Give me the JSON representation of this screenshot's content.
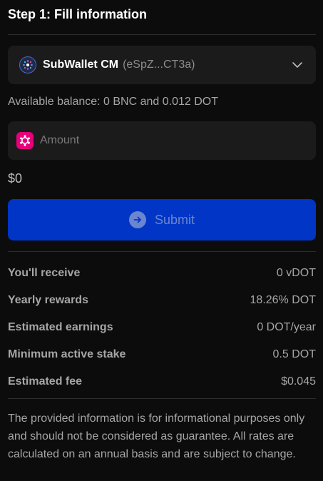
{
  "step_title": "Step 1: Fill information",
  "account": {
    "name": "SubWallet CM",
    "address": "(eSpZ...CT3a)",
    "icon": "subwallet-logo-icon"
  },
  "balance_text": "Available balance: 0 BNC and 0.012 DOT",
  "amount": {
    "placeholder": "Amount",
    "value": "",
    "token_icon": "polkadot-token-icon"
  },
  "usd_value": "$0",
  "submit": {
    "label": "Submit",
    "icon": "arrow-right-circle-icon"
  },
  "info": [
    {
      "label": "You'll receive",
      "value": "0 vDOT"
    },
    {
      "label": "Yearly rewards",
      "value": "18.26% DOT"
    },
    {
      "label": "Estimated earnings",
      "value": "0 DOT/year"
    },
    {
      "label": "Minimum active stake",
      "value": "0.5 DOT"
    },
    {
      "label": "Estimated fee",
      "value": "$0.045"
    }
  ],
  "disclaimer": "The provided information is for informational purposes only and should not be considered as guarantee. All rates are calculated on an annual basis and are subject to change.",
  "colors": {
    "background": "#0c0c0c",
    "panel": "#1b1b1b",
    "primary": "#0035c5",
    "polkadot": "#e6007a"
  }
}
